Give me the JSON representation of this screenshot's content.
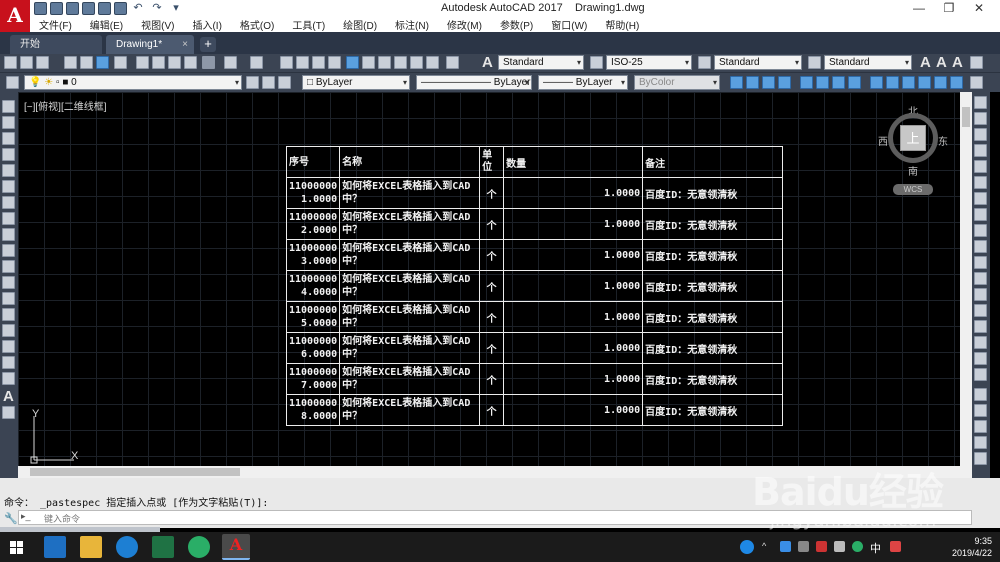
{
  "app": {
    "logo_letter": "A",
    "title": "Autodesk AutoCAD 2017",
    "filename": "Drawing1.dwg",
    "window_controls": [
      "—",
      "❐",
      "✕"
    ]
  },
  "menu": [
    "文件(F)",
    "编辑(E)",
    "视图(V)",
    "插入(I)",
    "格式(O)",
    "工具(T)",
    "绘图(D)",
    "标注(N)",
    "修改(M)",
    "参数(P)",
    "窗口(W)",
    "帮助(H)"
  ],
  "tabs": {
    "start": "开始",
    "drawing": "Drawing1*",
    "close": "×",
    "add": "+"
  },
  "styles_toolbar": {
    "text_style": "Standard",
    "dim_style": "ISO-25",
    "table_style": "Standard",
    "multileader_style": "Standard"
  },
  "properties_toolbar": {
    "layer": "0",
    "color": "ByLayer",
    "linetype": "ByLayer",
    "lineweight": "ByLayer",
    "plotstyle": "ByColor"
  },
  "viewport_label": "[−][俯视][二维线框]",
  "viewcube": {
    "north": "北",
    "south": "南",
    "east": "东",
    "west": "西",
    "face": "上",
    "wcs": "WCS"
  },
  "ucs": {
    "x": "X",
    "y": "Y"
  },
  "table": {
    "headers": [
      "序号",
      "名称",
      "单位",
      "数量",
      "备注"
    ],
    "header_unit_lines": [
      "单",
      "位"
    ],
    "rows": [
      {
        "seq_line1": "11000000",
        "seq_line2": "1.0000",
        "name_line1": "如何将EXCEL表格插入到CAD",
        "name_line2": "中？",
        "unit": "个",
        "qty": "1.0000",
        "note": "百度ID：无意领清秋"
      },
      {
        "seq_line1": "11000000",
        "seq_line2": "2.0000",
        "name_line1": "如何将EXCEL表格插入到CAD",
        "name_line2": "中？",
        "unit": "个",
        "qty": "1.0000",
        "note": "百度ID：无意领清秋"
      },
      {
        "seq_line1": "11000000",
        "seq_line2": "3.0000",
        "name_line1": "如何将EXCEL表格插入到CAD",
        "name_line2": "中？",
        "unit": "个",
        "qty": "1.0000",
        "note": "百度ID：无意领清秋"
      },
      {
        "seq_line1": "11000000",
        "seq_line2": "4.0000",
        "name_line1": "如何将EXCEL表格插入到CAD",
        "name_line2": "中？",
        "unit": "个",
        "qty": "1.0000",
        "note": "百度ID：无意领清秋"
      },
      {
        "seq_line1": "11000000",
        "seq_line2": "5.0000",
        "name_line1": "如何将EXCEL表格插入到CAD",
        "name_line2": "中？",
        "unit": "个",
        "qty": "1.0000",
        "note": "百度ID：无意领清秋"
      },
      {
        "seq_line1": "11000000",
        "seq_line2": "6.0000",
        "name_line1": "如何将EXCEL表格插入到CAD",
        "name_line2": "中？",
        "unit": "个",
        "qty": "1.0000",
        "note": "百度ID：无意领清秋"
      },
      {
        "seq_line1": "11000000",
        "seq_line2": "7.0000",
        "name_line1": "如何将EXCEL表格插入到CAD",
        "name_line2": "中？",
        "unit": "个",
        "qty": "1.0000",
        "note": "百度ID：无意领清秋"
      },
      {
        "seq_line1": "11000000",
        "seq_line2": "8.0000",
        "name_line1": "如何将EXCEL表格插入到CAD",
        "name_line2": "中？",
        "unit": "个",
        "qty": "1.0000",
        "note": "百度ID：无意领清秋"
      }
    ]
  },
  "command": {
    "history": "命令： _pastespec 指定插入点或 [作为文字粘贴(T)]:",
    "placeholder": "键入命令"
  },
  "taskbar": {
    "time": "9:35",
    "date": "2019/4/22",
    "ime": "中"
  },
  "watermark": {
    "logo": "Baidu经验",
    "url": "jingyan.baidu.com"
  }
}
